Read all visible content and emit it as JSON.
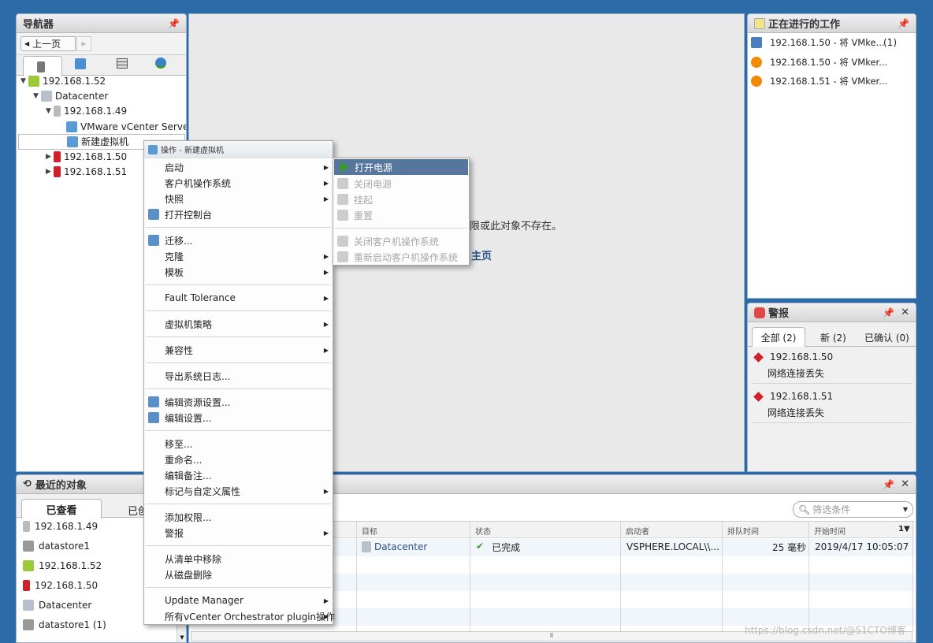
{
  "navigator": {
    "title": "导航器",
    "back_label": "上一页",
    "tabs": [
      "hosts-clusters-icon",
      "vms-templates-icon",
      "storage-icon",
      "network-icon"
    ],
    "tree": [
      {
        "label": "192.168.1.52",
        "level": 0,
        "icon": "vcenter-icon",
        "expanded": true
      },
      {
        "label": "Datacenter",
        "level": 1,
        "icon": "datacenter-icon",
        "expanded": true
      },
      {
        "label": "192.168.1.49",
        "level": 2,
        "icon": "host-icon",
        "expanded": true
      },
      {
        "label": "VMware vCenter Serve...",
        "level": 3,
        "icon": "vm-running-icon"
      },
      {
        "label": "新建虚拟机",
        "level": 3,
        "icon": "vm-icon",
        "selected": true
      },
      {
        "label": "192.168.1.50",
        "level": 2,
        "icon": "host-alert-icon",
        "expanded": false
      },
      {
        "label": "192.168.1.51",
        "level": 2,
        "icon": "host-alert-icon",
        "expanded": false
      }
    ]
  },
  "center": {
    "message": "限或此对象不存在。",
    "link": "主页"
  },
  "context_menu": {
    "title": "操作 - 新建虚拟机",
    "items": [
      {
        "label": "启动",
        "sub": true
      },
      {
        "label": "客户机操作系统",
        "sub": true
      },
      {
        "label": "快照",
        "sub": true
      },
      {
        "label": "打开控制台",
        "icon": "console-icon"
      },
      {
        "sep": true
      },
      {
        "label": "迁移...",
        "icon": "migrate-icon"
      },
      {
        "label": "克隆",
        "sub": true
      },
      {
        "label": "模板",
        "sub": true
      },
      {
        "sep": true
      },
      {
        "label": "Fault Tolerance",
        "sub": true
      },
      {
        "sep": true
      },
      {
        "label": "虚拟机策略",
        "sub": true
      },
      {
        "sep": true
      },
      {
        "label": "兼容性",
        "sub": true
      },
      {
        "sep": true
      },
      {
        "label": "导出系统日志..."
      },
      {
        "sep": true
      },
      {
        "label": "编辑资源设置...",
        "icon": "resource-settings-icon"
      },
      {
        "label": "编辑设置...",
        "icon": "edit-settings-icon"
      },
      {
        "sep": true
      },
      {
        "label": "移至..."
      },
      {
        "label": "重命名..."
      },
      {
        "label": "编辑备注..."
      },
      {
        "label": "标记与自定义属性",
        "sub": true
      },
      {
        "sep": true
      },
      {
        "label": "添加权限..."
      },
      {
        "label": "警报",
        "sub": true
      },
      {
        "sep": true
      },
      {
        "label": "从清单中移除"
      },
      {
        "label": "从磁盘删除"
      },
      {
        "sep": true
      },
      {
        "label": "Update Manager",
        "sub": true
      },
      {
        "label": "所有vCenter Orchestrator plugin操作",
        "sub": true
      }
    ]
  },
  "power_submenu": {
    "items": [
      {
        "label": "打开电源",
        "icon": "power-on-icon",
        "highlighted": true
      },
      {
        "label": "关闭电源",
        "icon": "power-off-icon",
        "disabled": true
      },
      {
        "label": "挂起",
        "icon": "suspend-icon",
        "disabled": true
      },
      {
        "label": "重置",
        "icon": "reset-icon",
        "disabled": true
      },
      {
        "sep": true
      },
      {
        "label": "关闭客户机操作系统",
        "icon": "shutdown-guest-icon",
        "disabled": true
      },
      {
        "label": "重新启动客户机操作系统",
        "icon": "restart-guest-icon",
        "disabled": true
      }
    ]
  },
  "work_in_progress": {
    "title": "正在进行的工作",
    "items": [
      {
        "label": "192.168.1.50 - 将 VMke...",
        "count": "(1)",
        "icon": "task-icon"
      },
      {
        "label": "192.168.1.50 - 将 VMker...",
        "icon": "warning-icon"
      },
      {
        "label": "192.168.1.51 - 将 VMker...",
        "icon": "warning-icon"
      }
    ]
  },
  "alarms": {
    "title": "警报",
    "tabs": [
      "全部 (2)",
      "新 (2)",
      "已确认 (0)"
    ],
    "items": [
      {
        "host": "192.168.1.50",
        "message": "网络连接丢失"
      },
      {
        "host": "192.168.1.51",
        "message": "网络连接丢失"
      }
    ]
  },
  "recent": {
    "title": "最近的对象",
    "tabs": [
      "已查看",
      "已创"
    ],
    "items": [
      {
        "label": "192.168.1.49",
        "icon": "host-icon"
      },
      {
        "label": "datastore1",
        "icon": "datastore-icon"
      },
      {
        "label": "192.168.1.52",
        "icon": "vcenter-icon"
      },
      {
        "label": "192.168.1.50",
        "icon": "host-alert-icon"
      },
      {
        "label": "Datacenter",
        "icon": "datacenter-icon"
      },
      {
        "label": "datastore1 (1)",
        "icon": "datastore-icon"
      }
    ]
  },
  "tasks": {
    "filter_placeholder": "筛选条件",
    "columns": [
      "目标",
      "状态",
      "启动者",
      "排队时间",
      "开始时间"
    ],
    "sort_indicator": "1▼",
    "rows": [
      {
        "target": "Datacenter",
        "status": "已完成",
        "initiator": "VSPHERE.LOCAL\\\\...",
        "queued": "25 毫秒",
        "start": "2019/4/17 10:05:07"
      }
    ]
  },
  "watermark": "https://blog.csdn.net/@51CTO博客",
  "colors": {
    "background": "#2d6aa8",
    "menu_highlight": "#57769e",
    "link": "#2a4f86",
    "ok": "#3a9a2a",
    "warning": "#f08a00",
    "alert": "#d0202a"
  }
}
